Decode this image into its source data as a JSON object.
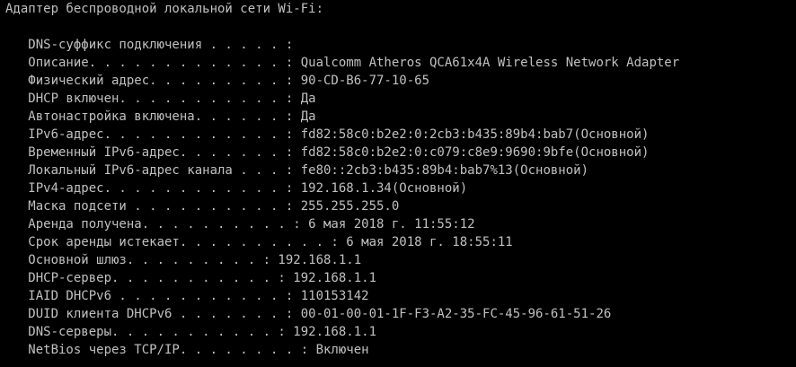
{
  "console": {
    "colors": {
      "background": "#000000",
      "text": "#c0c0c0"
    },
    "header": "Адаптер беспроводной локальной сети Wi-Fi:",
    "lines": [
      "   DNS-суффикс подключения . . . . . :",
      "   Описание. . . . . . . . . . . . . : Qualcomm Atheros QCA61x4A Wireless Network Adapter",
      "   Физический адрес. . . . . . . . . : 90-CD-B6-77-10-65",
      "   DHCP включен. . . . . . . . . . . : Да",
      "   Автонастройка включена. . . . . . : Да",
      "   IPv6-адрес. . . . . . . . . . . . : fd82:58c0:b2e2:0:2cb3:b435:89b4:bab7(Основной)",
      "   Временный IPv6-адрес. . . . . . . : fd82:58c0:b2e2:0:c079:c8e9:9690:9bfe(Основной)",
      "   Локальный IPv6-адрес канала . . . : fe80::2cb3:b435:89b4:bab7%13(Основной)",
      "   IPv4-адрес. . . . . . . . . . . . : 192.168.1.34(Основной)",
      "   Маска подсети . . . . . . . . . . : 255.255.255.0",
      "   Аренда получена. . . . . . . . . . : 6 мая 2018 г. 11:55:12",
      "   Срок аренды истекает. . . . . . . . . . : 6 мая 2018 г. 18:55:11",
      "   Основной шлюз. . . . . . . . . : 192.168.1.1",
      "   DHCP-сервер. . . . . . . . . . . : 192.168.1.1",
      "   IAID DHCPv6 . . . . . . . . . . . : 110153142",
      "   DUID клиента DHCPv6 . . . . . . . : 00-01-00-01-1F-F3-A2-35-FC-45-96-61-51-26",
      "   DNS-серверы. . . . . . . . . . . : 192.168.1.1",
      "   NetBios через TCP/IP. . . . . . . . : Включен"
    ]
  }
}
